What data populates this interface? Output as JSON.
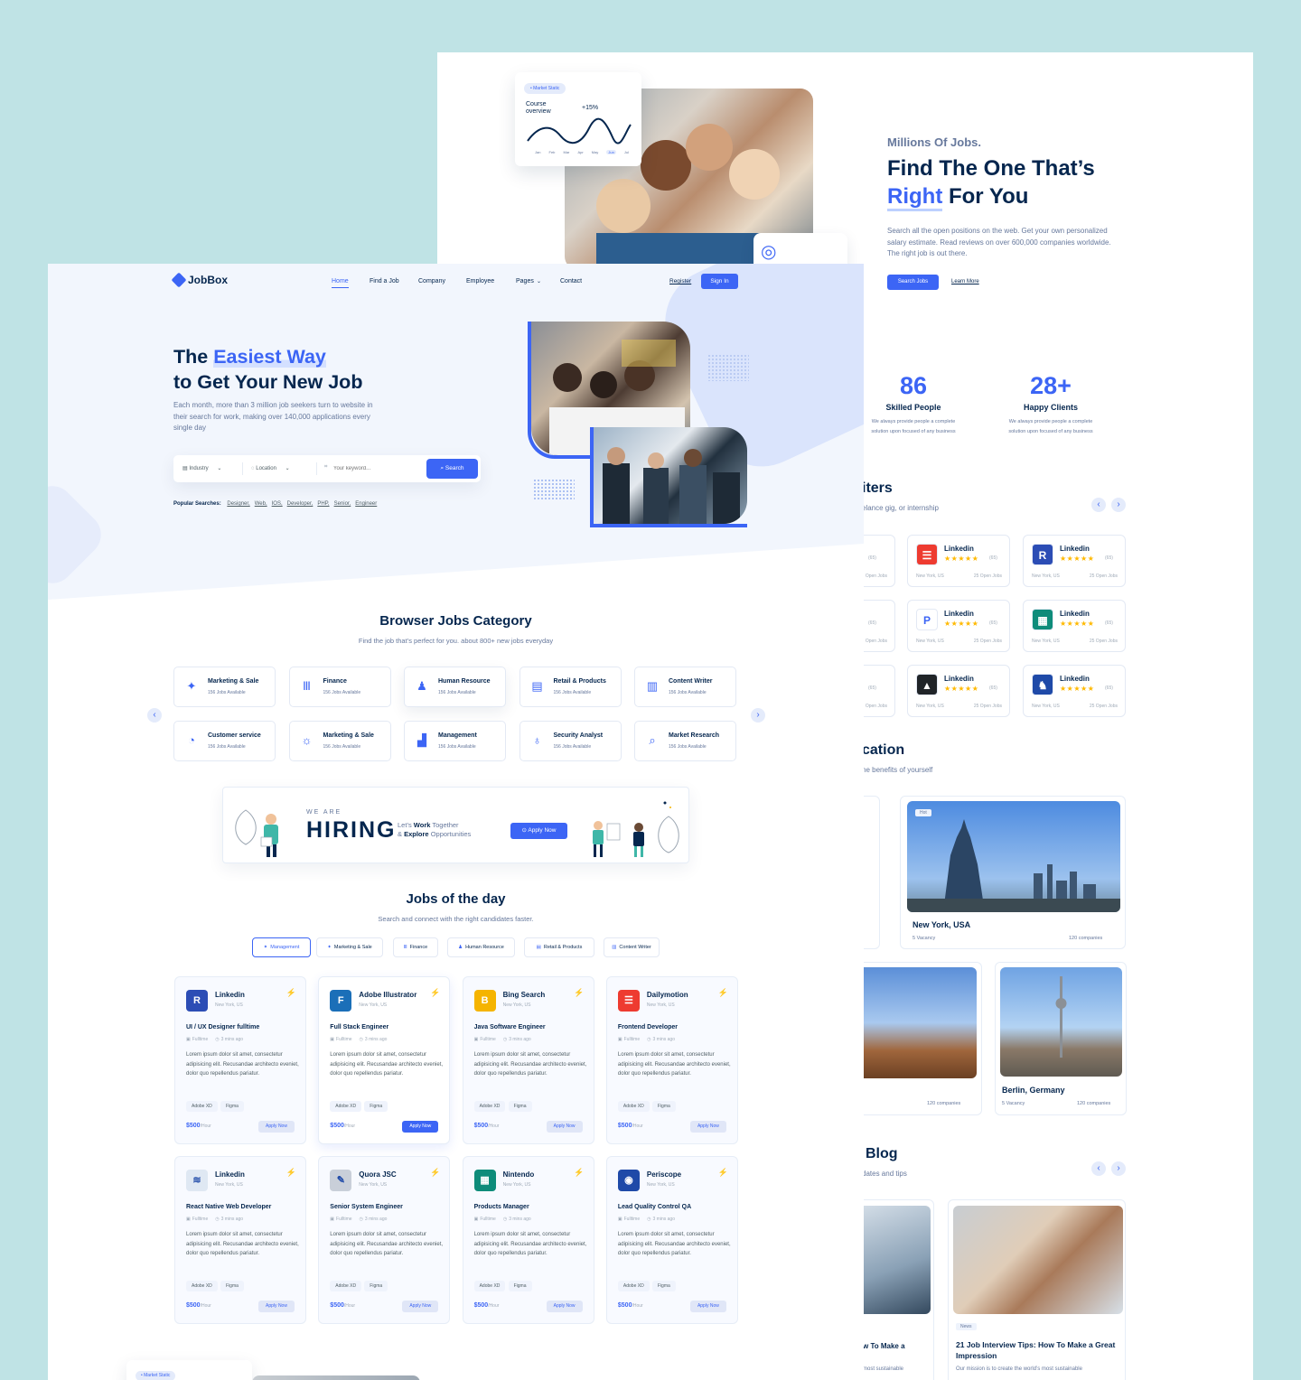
{
  "back": {
    "chart_card": {
      "tag": "Market Static",
      "title": "Course overview",
      "delta": "+15%",
      "months": [
        "Jan",
        "Feb",
        "Mar",
        "Apr",
        "May",
        "Jun",
        "Jul"
      ]
    },
    "hero": {
      "kicker": "Millions Of Jobs.",
      "title_line1": "Find The One That’s",
      "title_accent": "Right",
      "title_rest": " For You",
      "desc": "Search all the open positions on the web. Get your own personalized salary estimate. Read reviews on over 600,000 companies worldwide. The right job is out there.",
      "btn_search": "Search Jobs",
      "btn_learn": "Learn More"
    },
    "stats": [
      {
        "num": "86",
        "label": "Skilled People",
        "desc": "We always provide people a complete solution upon focused of any business"
      },
      {
        "num": "28+",
        "label": "Happy Clients",
        "desc": "We always provide people a complete solution upon focused of any business"
      }
    ],
    "recruiters": {
      "title": "iters",
      "subtitle": "elance gig, or internship",
      "prev": "‹",
      "next": "›",
      "cards": [
        {
          "name": "Linkedin",
          "count": "(65)",
          "loc": "New York, US",
          "open": "25 Open Jobs",
          "color": "#ee3b30",
          "glyph": "☰"
        },
        {
          "name": "Linkedin",
          "count": "(65)",
          "loc": "New York, US",
          "open": "25 Open Jobs",
          "color": "#2c4db5",
          "glyph": "R"
        },
        {
          "name": "Linkedin",
          "count": "(65)",
          "loc": "New York, US",
          "open": "25 Open Jobs",
          "color": "#ffffff",
          "glyph": "P"
        },
        {
          "name": "Linkedin",
          "count": "(65)",
          "loc": "New York, US",
          "open": "25 Open Jobs",
          "color": "#0e8c7a",
          "glyph": "▦"
        },
        {
          "name": "Linkedin",
          "count": "(65)",
          "loc": "New York, US",
          "open": "25 Open Jobs",
          "color": "#202428",
          "glyph": "▲"
        },
        {
          "name": "Linkedin",
          "count": "(65)",
          "loc": "New York, US",
          "open": "25 Open Jobs",
          "color": "#1f4aa8",
          "glyph": "♞"
        }
      ],
      "left_partial": [
        "(65)",
        "Open Jobs"
      ]
    },
    "location": {
      "title": "cation",
      "subtitle": "he benefits of yourself",
      "nyc": {
        "badge": "Hot",
        "name": "New York, USA",
        "vacancy": "5 Vacancy",
        "companies": "120 companies"
      },
      "partial_companies": "nies",
      "mid_companies": "120 companies",
      "berlin": {
        "name": "Berlin, Germany",
        "vacancy": "5 Vacancy",
        "companies": "120 companies"
      }
    },
    "blog": {
      "title": "Blog",
      "subtitle": "dates and tips",
      "prev": "‹",
      "next": "›",
      "partial_title": "w To Make a",
      "partial_desc": "most sustainable",
      "post": {
        "tag": "News",
        "title": "21 Job Interview Tips: How To Make a Great Impression",
        "desc": "Our mission is to create the world’s most sustainable"
      }
    }
  },
  "front": {
    "logo": "JobBox",
    "nav": [
      "Home",
      "Find a Job",
      "Company",
      "Employee",
      "Pages",
      "Contact"
    ],
    "register": "Register",
    "signin": "Sign In",
    "hero": {
      "title_pre": "The ",
      "title_accent": "Easiest Way",
      "title_line2": "to Get Your New Job",
      "desc": "Each month, more than 3 million job seekers turn to website in their search for work, making over 140,000 applications every single day"
    },
    "search": {
      "industry": "Industry",
      "location": "Location",
      "keyword_placeholder": "Your keyword...",
      "button": "Search"
    },
    "popular": {
      "label": "Popular Searches:",
      "items": [
        "Designer,",
        "Web,",
        "IOS,",
        "Developer,",
        "PHP,",
        "Senior,",
        "Engineer"
      ]
    },
    "category": {
      "title": "Browser Jobs Category",
      "subtitle": "Find the job that’s perfect for you. about 800+ new jobs everyday",
      "items": [
        {
          "name": "Marketing & Sale",
          "jobs": "156 Jobs Available",
          "icon": "✦"
        },
        {
          "name": "Finance",
          "jobs": "156 Jobs Available",
          "icon": "Ⅲ"
        },
        {
          "name": "Human Resource",
          "jobs": "156 Jobs Available",
          "icon": "♟"
        },
        {
          "name": "Retail & Products",
          "jobs": "156 Jobs Available",
          "icon": "▤"
        },
        {
          "name": "Content Writer",
          "jobs": "156 Jobs Available",
          "icon": "▥"
        },
        {
          "name": "Customer service",
          "jobs": "156 Jobs Available",
          "icon": "◔"
        },
        {
          "name": "Marketing & Sale",
          "jobs": "156 Jobs Available",
          "icon": "☼"
        },
        {
          "name": "Management",
          "jobs": "156 Jobs Available",
          "icon": "▟"
        },
        {
          "name": "Security Analyst",
          "jobs": "156 Jobs Available",
          "icon": "♁"
        },
        {
          "name": "Market Research",
          "jobs": "156 Jobs Available",
          "icon": "⌕"
        }
      ],
      "prev": "‹",
      "next": "›"
    },
    "hiring": {
      "we_are": "WE ARE",
      "hiring": "HIRING",
      "line1_pre": "Let’s ",
      "line1_b": "Work",
      "line1_post": " Together",
      "line2_pre": "& ",
      "line2_b": "Explore",
      "line2_post": " Opportunities",
      "button": "Apply Now"
    },
    "jobs": {
      "title": "Jobs of the day",
      "subtitle": "Search and connect with the right candidates faster.",
      "tabs": [
        "Management",
        "Marketing & Sale",
        "Finance",
        "Human Resource",
        "Retail & Products",
        "Content Writer"
      ],
      "cards": [
        {
          "company": "Linkedin",
          "loc": "New York, US",
          "title": "UI / UX Designer fulltime",
          "type": "Fulltime",
          "ago": "3 mins ago",
          "color": "#2c4db5",
          "glyph": "R"
        },
        {
          "company": "Adobe Illustrator",
          "loc": "New York, US",
          "title": "Full Stack Engineer",
          "type": "Fulltime",
          "ago": "3 mins ago",
          "color": "#1b6fb8",
          "glyph": "F"
        },
        {
          "company": "Bing Search",
          "loc": "New York, US",
          "title": "Java Software Engineer",
          "type": "Fulltime",
          "ago": "3 mins ago",
          "color": "#f5b400",
          "glyph": "B"
        },
        {
          "company": "Dailymotion",
          "loc": "New York, US",
          "title": "Frontend Developer",
          "type": "Fulltime",
          "ago": "3 mins ago",
          "color": "#ee3b30",
          "glyph": "☰"
        },
        {
          "company": "Linkedin",
          "loc": "New York, US",
          "title": "React Native Web Developer",
          "type": "Fulltime",
          "ago": "3 mins ago",
          "color": "#dfe8f3",
          "glyph": "≋"
        },
        {
          "company": "Quora JSC",
          "loc": "New York, US",
          "title": "Senior System Engineer",
          "type": "Fulltime",
          "ago": "3 mins ago",
          "color": "#c9cfd9",
          "glyph": "✎"
        },
        {
          "company": "Nintendo",
          "loc": "New York, US",
          "title": "Products Manager",
          "type": "Fulltime",
          "ago": "3 mins ago",
          "color": "#0e8c7a",
          "glyph": "▦"
        },
        {
          "company": "Periscope",
          "loc": "New York, US",
          "title": "Lead Quality Control QA",
          "type": "Fulltime",
          "ago": "3 mins ago",
          "color": "#1f4aa8",
          "glyph": "◉"
        }
      ],
      "desc": "Lorem ipsum dolor sit amet, consectetur adipisicing elit. Recusandae architecto eveniet, dolor quo repellendus pariatur.",
      "tags": [
        "Adobe XD",
        "Figma"
      ],
      "price": "$500",
      "per": "/Hour",
      "apply": "Apply Now"
    },
    "bottom_tag": "Market Static"
  }
}
